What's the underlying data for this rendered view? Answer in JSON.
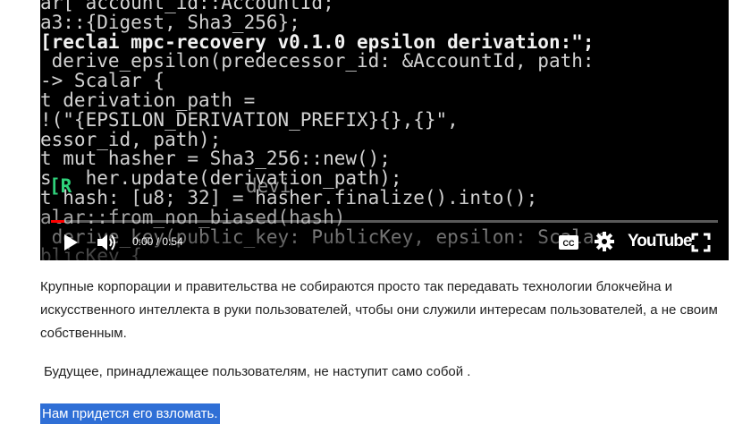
{
  "video": {
    "code_lines": [
      "ar[ account_id::AccountId;",
      "a3::{Digest, Sha3_256};",
      "[reclai mpc-recovery v0.1.0 epsilon derivation:\";",
      " derive_epsilon(predecessor_id: &AccountId, path:",
      "-> Scalar {",
      "t derivation_path =",
      "!(\"{EPSILON_DERIVATION_PREFIX}{},{}\",",
      "essor_id, path);",
      "t mut hasher = Sha3_256::new();",
      "s   her.update(derivation_path);",
      "t hash: [u8; 32] = hasher.finalize().into();",
      "alar::from_non_biased(hash)",
      " derive_key(public_key: PublicKey, epsilon: Scalar",
      "blicKey {"
    ],
    "glitch_text": "[R",
    "overlay_text": "devi",
    "time_display": "0:00 / 0:54",
    "progress_fraction": 0.02,
    "youtube_label": "YouTube",
    "icons": [
      "play-icon",
      "volume-icon",
      "captions-icon",
      "settings-gear-icon",
      "fullscreen-icon"
    ]
  },
  "article": {
    "paragraph_1": "Крупные корпорации и правительства не собираются просто так передавать технологии блокчейна и искусственного интеллекта в руки пользователей, чтобы они служили интересам пользователей, а не своим собственным.",
    "paragraph_2": "Будущее, принадлежащее пользователям, не наступит само собой .",
    "paragraph_3_selected": "Нам придется его взломать."
  },
  "colors": {
    "selection": "#2f6fd6",
    "progress_played": "#ff0000"
  }
}
